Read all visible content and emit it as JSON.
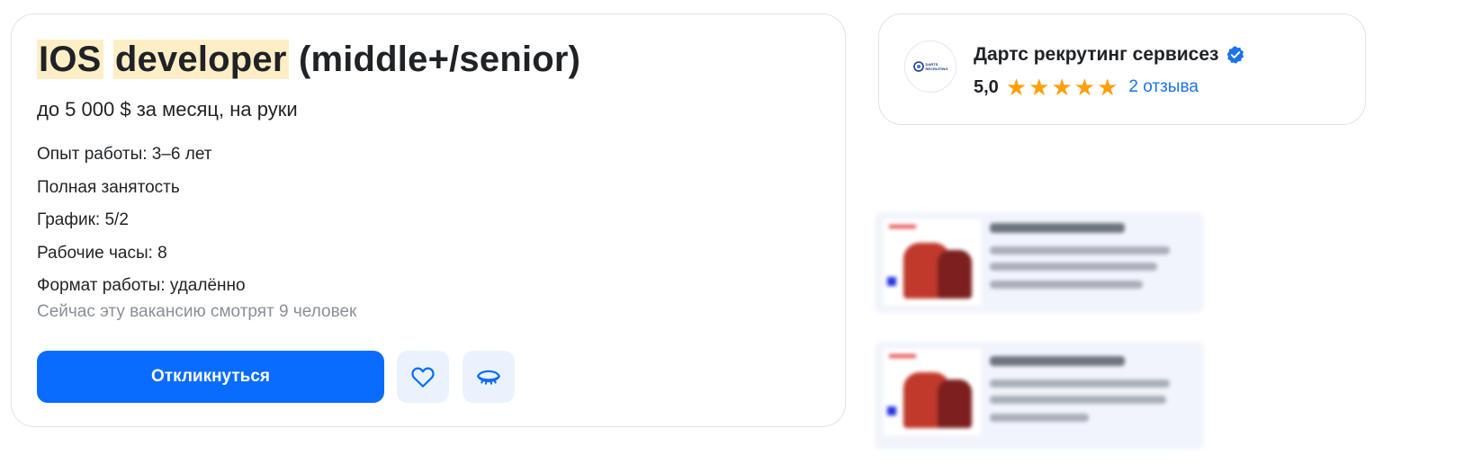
{
  "vacancy": {
    "title_part1": "IOS",
    "title_part2": "developer",
    "title_part3": "(middle+/senior)",
    "salary": "до 5 000 $ за месяц, на руки",
    "facts": [
      "Опыт работы: 3–6 лет",
      "Полная занятость",
      "График: 5/2",
      "Рабочие часы: 8",
      "Формат работы: удалённо"
    ],
    "viewers": "Сейчас эту вакансию смотрят 9 человек",
    "apply_label": "Откликнуться",
    "favorite_icon": "heart-icon",
    "hide_icon": "eye-closed-icon"
  },
  "employer": {
    "name": "Дартс рекрутинг сервисез",
    "logo_text_line1": "DARTS",
    "logo_text_line2": "RECRUITING",
    "verified_icon": "verified-badge-icon",
    "rating": "5,0",
    "stars": 5,
    "reviews_label": "2 отзыва"
  },
  "colors": {
    "accent": "#0a6cff",
    "highlight": "#fdeec6",
    "star": "#ff9f0a",
    "link": "#1a73e8",
    "muted_text": "#8a8f98",
    "icon_button_bg": "#eaf3fd"
  }
}
